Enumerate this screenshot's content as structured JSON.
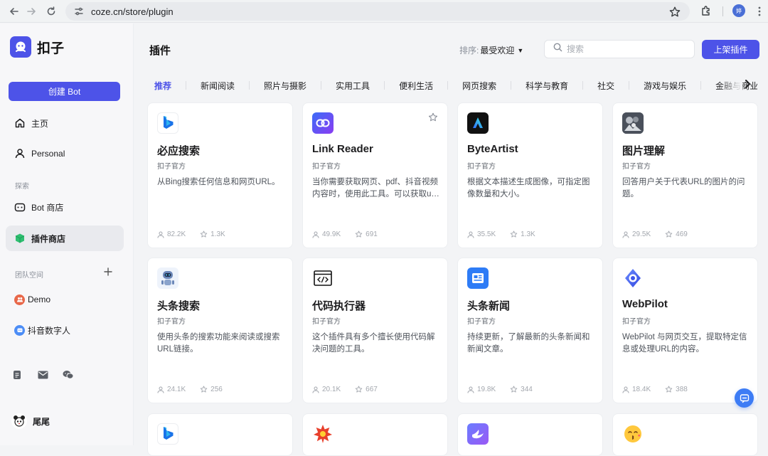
{
  "browser": {
    "url": "coze.cn/store/plugin",
    "profile_initial": "婷"
  },
  "sidebar": {
    "logo_text": "扣子",
    "create_label": "创建 Bot",
    "nav": [
      {
        "label": "主页",
        "icon": "home-icon"
      },
      {
        "label": "Personal",
        "icon": "user-icon"
      }
    ],
    "explore_section": "探索",
    "explore": [
      {
        "label": "Bot 商店",
        "icon": "bot-icon"
      },
      {
        "label": "插件商店",
        "icon": "cube-icon",
        "active": true
      }
    ],
    "team_section": "团队空间",
    "teams": [
      {
        "label": "Demo",
        "color": "#e8684a"
      },
      {
        "label": "抖音数字人",
        "color": "#4c8df6"
      }
    ],
    "user_name": "尾尾"
  },
  "header": {
    "title": "插件",
    "sort_label": "排序:",
    "sort_value": "最受欢迎",
    "search_placeholder": "搜索",
    "publish_label": "上架插件"
  },
  "tabs": [
    "推荐",
    "新闻阅读",
    "照片与摄影",
    "实用工具",
    "便利生活",
    "网页搜索",
    "科学与教育",
    "社交",
    "游戏与娱乐",
    "金融与商业"
  ],
  "plugins": [
    {
      "title": "必应搜索",
      "author": "扣子官方",
      "desc": "从Bing搜索任何信息和网页URL。",
      "users": "82.2K",
      "stars": "1.3K",
      "icon": "bing-icon"
    },
    {
      "title": "Link Reader",
      "author": "扣子官方",
      "desc": "当你需要获取网页、pdf、抖音视频内容时，使用此工具。可以获取url链接下的标题和内容。",
      "users": "49.9K",
      "stars": "691",
      "icon": "link-icon"
    },
    {
      "title": "ByteArtist",
      "author": "扣子官方",
      "desc": "根据文本描述生成图像，可指定图像数量和大小。",
      "users": "35.5K",
      "stars": "1.3K",
      "icon": "byteartist-icon"
    },
    {
      "title": "图片理解",
      "author": "扣子官方",
      "desc": "回答用户关于代表URL的图片的问题。",
      "users": "29.5K",
      "stars": "469",
      "icon": "image-understand-icon"
    },
    {
      "title": "头条搜索",
      "author": "扣子官方",
      "desc": "使用头条的搜索功能来阅读或搜索URL链接。",
      "users": "24.1K",
      "stars": "256",
      "icon": "robot-icon"
    },
    {
      "title": "代码执行器",
      "author": "扣子官方",
      "desc": "这个插件具有多个擅长使用代码解决问题的工具。",
      "users": "20.1K",
      "stars": "667",
      "icon": "code-icon"
    },
    {
      "title": "头条新闻",
      "author": "扣子官方",
      "desc": "持续更新，了解最新的头条新闻和新闻文章。",
      "users": "19.8K",
      "stars": "344",
      "icon": "news-icon"
    },
    {
      "title": "WebPilot",
      "author": "扣子官方",
      "desc": "WebPilot 与网页交互，提取特定信息或处理URL的内容。",
      "users": "18.4K",
      "stars": "388",
      "icon": "webpilot-icon"
    }
  ],
  "bottom_row_icons": [
    "bing-icon",
    "burst-icon",
    "bird-icon",
    "emoji-kiss-icon"
  ]
}
